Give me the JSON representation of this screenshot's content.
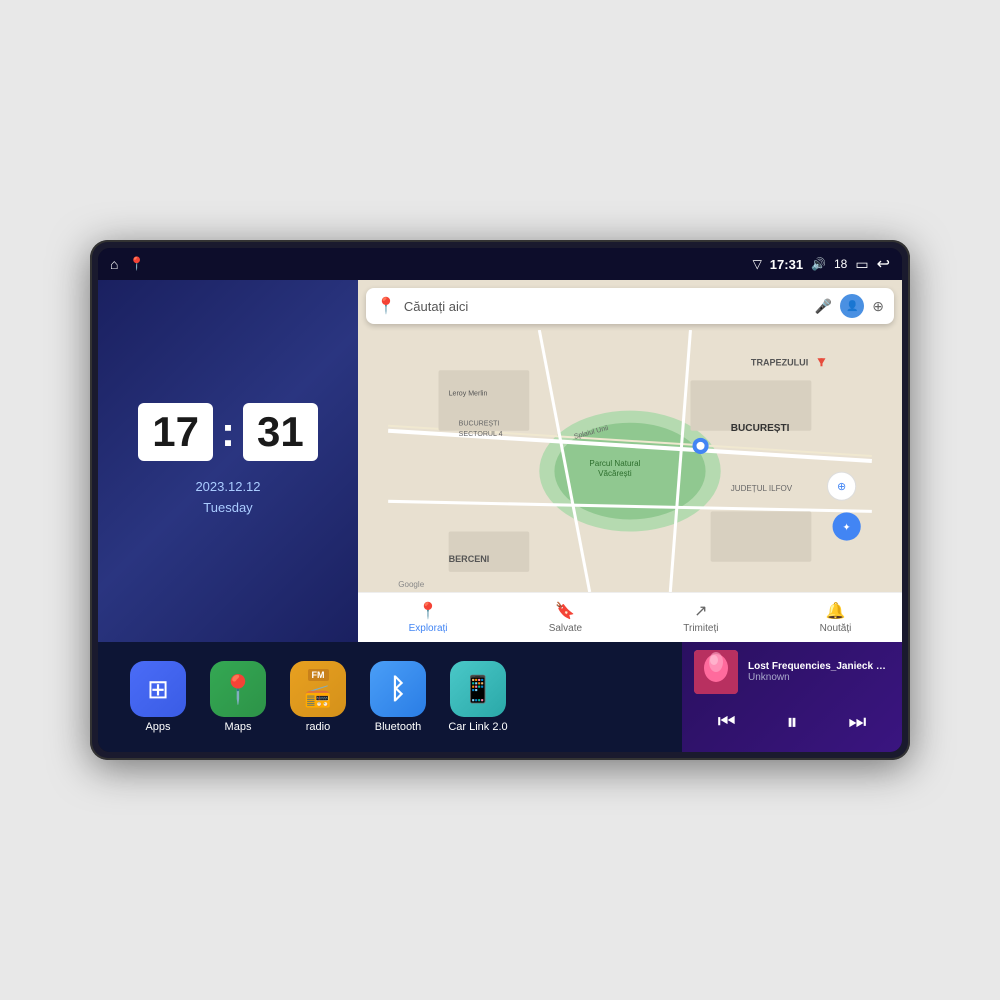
{
  "device": {
    "status_bar": {
      "time": "17:31",
      "signal_icon": "▽",
      "volume_icon": "🔊",
      "volume_level": "18",
      "battery_icon": "▭",
      "back_icon": "↩",
      "home_icon": "⌂",
      "location_icon": "📍"
    },
    "clock": {
      "hour": "17",
      "minute": "31",
      "date": "2023.12.12",
      "day": "Tuesday"
    },
    "map": {
      "search_placeholder": "Căutați aici",
      "tab_explore": "Explorați",
      "tab_saved": "Salvate",
      "tab_share": "Trimiteți",
      "tab_news": "Noutăți",
      "labels": [
        "TRAPEZULUI",
        "BUCUREȘTI",
        "JUDEȚUL ILFOV",
        "BERCENI",
        "Parcul Natural Văcărești",
        "Leroy Merlin",
        "BUCUREȘTI\nSECTORUL 4",
        "Splaiul Unii",
        "Google"
      ]
    },
    "apps": [
      {
        "id": "apps",
        "label": "Apps",
        "bg_class": "apps-bg",
        "icon": "⊞"
      },
      {
        "id": "maps",
        "label": "Maps",
        "bg_class": "maps-bg",
        "icon": "📍"
      },
      {
        "id": "radio",
        "label": "radio",
        "bg_class": "radio-bg",
        "icon": "📻"
      },
      {
        "id": "bluetooth",
        "label": "Bluetooth",
        "bg_class": "bluetooth-bg",
        "icon": "⚡"
      },
      {
        "id": "carlink",
        "label": "Car Link 2.0",
        "bg_class": "carlink-bg",
        "icon": "📱"
      }
    ],
    "music": {
      "title": "Lost Frequencies_Janieck Devy-...",
      "artist": "Unknown",
      "prev_icon": "⏮",
      "play_icon": "⏸",
      "next_icon": "⏭"
    }
  }
}
